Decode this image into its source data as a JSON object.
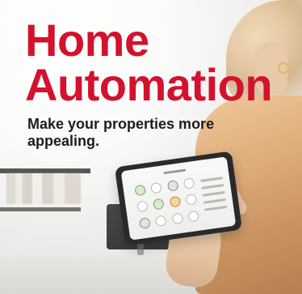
{
  "headline": {
    "line1": "Home",
    "line2": "Automation"
  },
  "subtext": {
    "line1": "Make your properties more",
    "line2": "appealing."
  },
  "colors": {
    "headline": "#d3122d",
    "subtext": "#1d1d1d",
    "tablet": "#2a2a2d",
    "jacket": "#d8a673"
  },
  "icons": {
    "tablet_icons": [
      "lightbulb-icon",
      "thermostat-icon",
      "camera-icon",
      "lock-icon",
      "power-icon",
      "fan-icon",
      "speaker-icon",
      "home-icon",
      "shield-icon",
      "settings-icon",
      "battery-icon",
      "wifi-icon"
    ]
  }
}
